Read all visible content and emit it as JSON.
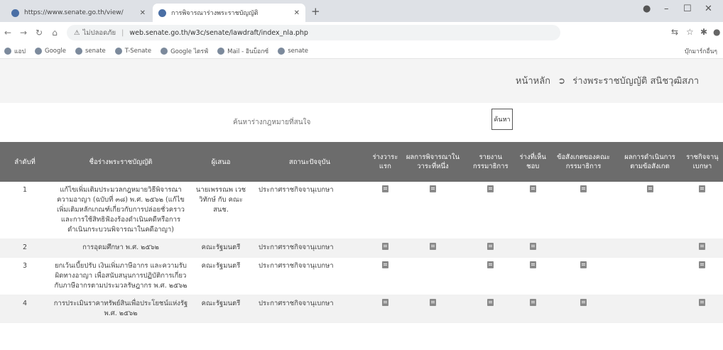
{
  "browser": {
    "tabs": [
      {
        "title": "https://www.senate.go.th/view/"
      },
      {
        "title": "การพิจารณาร่างพระราชบัญญัติ"
      }
    ],
    "new_tab": "+",
    "address": {
      "security": "ไม่ปลอดภัย",
      "url": "web.senate.go.th/w3c/senate/lawdraft/index_nla.php"
    },
    "bookmarks": [
      "แอป",
      "Google",
      "senate",
      "T-Senate",
      "Google ไดรฟ์",
      "Mail - อินบ็อกซ์",
      "senate"
    ],
    "bookmarks_right": "บุ๊กมาร์กอื่นๆ"
  },
  "breadcrumb": {
    "home": "หน้าหลัก",
    "arrow": "➲",
    "current": "ร่างพระราชบัญญัติ สนิชวุฒิสภา"
  },
  "search": {
    "placeholder": "ค้นหาร่างกฎหมายที่สนใจ",
    "button": "ค้นหา"
  },
  "table": {
    "headers": [
      "ลำดับที่",
      "ชื่อร่างพระราชบัญญัติ",
      "ผู้เสนอ",
      "สถานะปัจจุบัน",
      "ร่างวาระแรก",
      "ผลการพิจารณาในวาระที่หนึ่ง",
      "รายงานกรรมาธิการ",
      "ร่างที่เห็นชอบ",
      "ข้อสังเกตของคณะกรรมาธิการ",
      "ผลการดำเนินการตามข้อสังเกต",
      "ราชกิจจานุเบกษา"
    ],
    "rows": [
      {
        "num": "1",
        "title": "แก้ไขเพิ่มเติมประมวลกฎหมายวิธีพิจารณาความอาญา (ฉบับที่ ๓๘) พ.ศ. ๒๕๖๒ (แก้ไขเพิ่มเติมหลักเกณฑ์เกี่ยวกับการปล่อยชั่วคราว และการใช้สิทธิฟ้องร้องดำเนินคดีหรือการดำเนินกระบวนพิจารณาในคดีอาญา)",
        "proposer": "นายเพรรณพ เวชวิทักษ์ กับ คณะ สนช.",
        "status": "ประกาศราชกิจจานุเบกษา",
        "docs": [
          true,
          true,
          true,
          true,
          true,
          true,
          true
        ]
      },
      {
        "num": "2",
        "title": "การอุดมศึกษา พ.ศ. ๒๕๖๒",
        "proposer": "คณะรัฐมนตรี",
        "status": "ประกาศราชกิจจานุเบกษา",
        "docs": [
          true,
          true,
          true,
          true,
          false,
          false,
          true
        ]
      },
      {
        "num": "3",
        "title": "ยกเว้นเบี้ยปรับ เงินเพิ่มภาษีอากร และความรับผิดทางอาญา เพื่อสนับสนุนการปฏิบัติการเกี่ยวกับภาษีอากรตามประมวลรัษฎากร พ.ศ. ๒๕๖๒",
        "proposer": "คณะรัฐมนตรี",
        "status": "ประกาศราชกิจจานุเบกษา",
        "docs": [
          true,
          false,
          true,
          true,
          true,
          false,
          true
        ]
      },
      {
        "num": "4",
        "title": "การประเมินราคาทรัพย์สินเพื่อประโยชน์แห่งรัฐ พ.ศ. ๒๕๖๒",
        "proposer": "คณะรัฐมนตรี",
        "status": "ประกาศราชกิจจานุเบกษา",
        "docs": [
          true,
          true,
          true,
          true,
          true,
          false,
          true
        ]
      }
    ]
  }
}
